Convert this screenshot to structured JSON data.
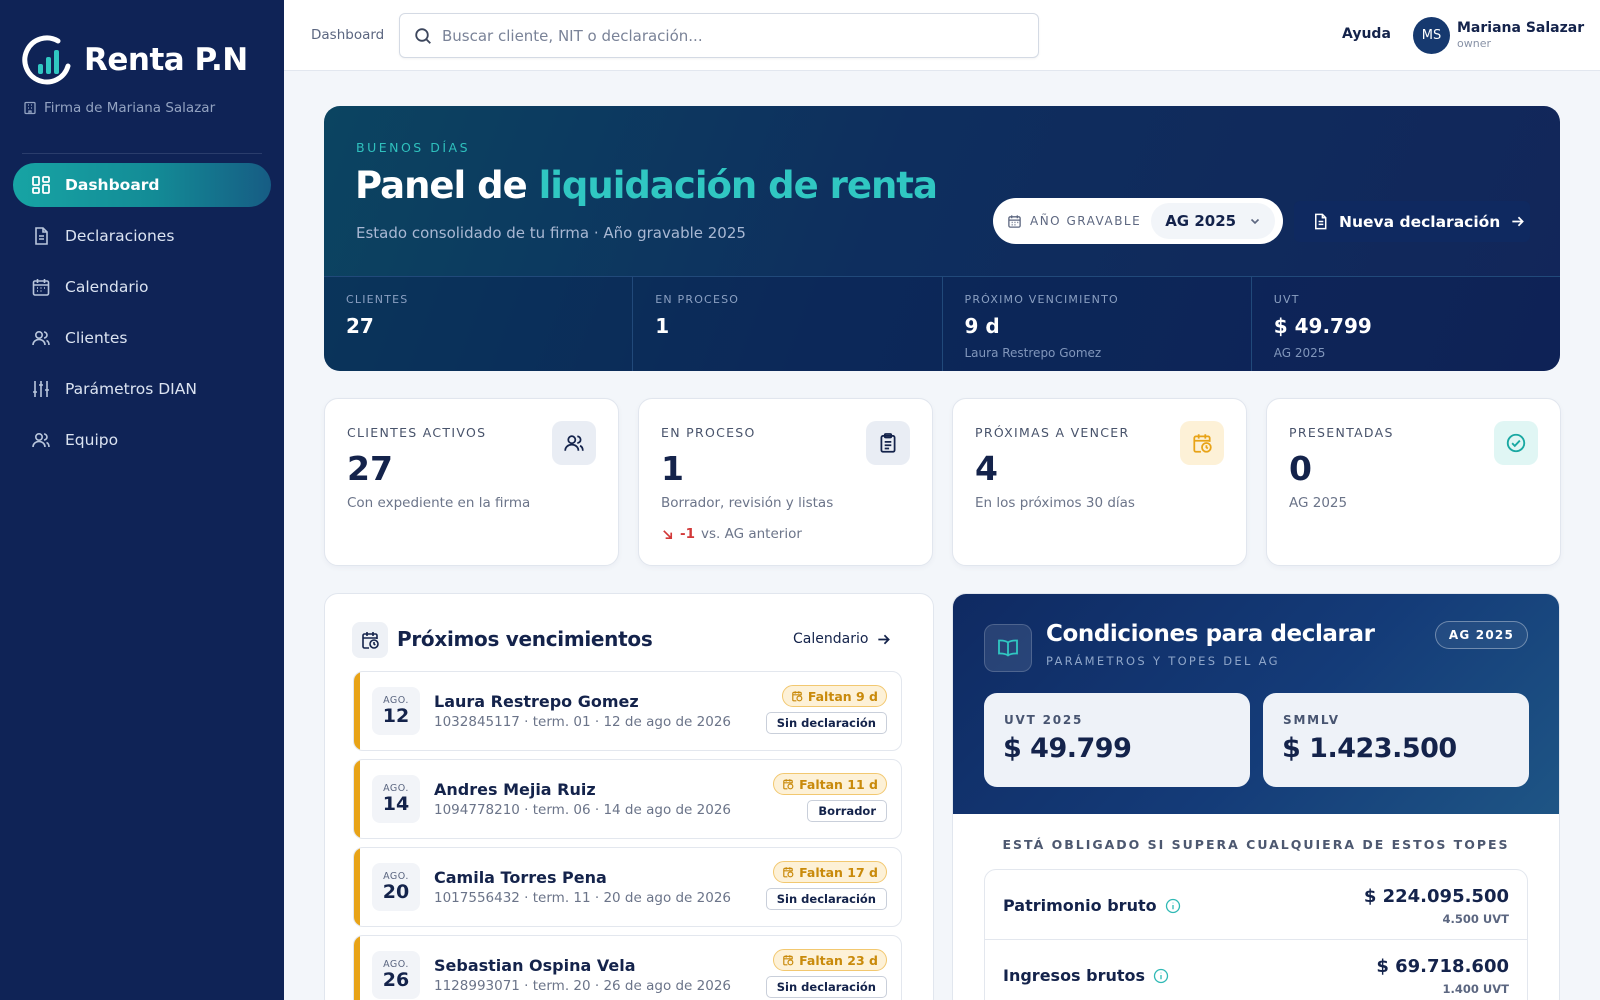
{
  "sidebar": {
    "brand": "Renta P.N",
    "firm": "Firma de Mariana Salazar",
    "items": [
      {
        "label": "Dashboard",
        "icon": "dashboard-grid-icon",
        "active": true
      },
      {
        "label": "Declaraciones",
        "icon": "document-icon"
      },
      {
        "label": "Calendario",
        "icon": "calendar-icon"
      },
      {
        "label": "Clientes",
        "icon": "users-icon"
      },
      {
        "label": "Parámetros DIAN",
        "icon": "sliders-icon"
      },
      {
        "label": "Equipo",
        "icon": "team-icon"
      }
    ]
  },
  "header": {
    "breadcrumb": "Dashboard",
    "search_placeholder": "Buscar cliente, NIT o declaración...",
    "help": "Ayuda",
    "user": {
      "initials": "MS",
      "name": "Mariana Salazar",
      "role": "owner"
    }
  },
  "hero": {
    "greeting": "BUENOS DÍAS",
    "title_prefix": "Panel de ",
    "title_accent": "liquidación de renta",
    "subtitle": "Estado consolidado de tu firma · Año gravable 2025",
    "year_label": "AÑO GRAVABLE",
    "year_value": "AG 2025",
    "new_button": "Nueva declaración",
    "stats": [
      {
        "label": "CLIENTES",
        "value": "27",
        "note": ""
      },
      {
        "label": "EN PROCESO",
        "value": "1",
        "note": ""
      },
      {
        "label": "PRÓXIMO VENCIMIENTO",
        "value": "9 d",
        "note": "Laura Restrepo Gomez"
      },
      {
        "label": "UVT",
        "value": "$ 49.799",
        "note": "AG 2025"
      }
    ]
  },
  "kpis": [
    {
      "label": "CLIENTES ACTIVOS",
      "value": "27",
      "desc": "Con expediente en la firma",
      "icon": "users-icon"
    },
    {
      "label": "EN PROCESO",
      "value": "1",
      "desc": "Borrador, revisión y listas",
      "trend_value": "-1",
      "trend_text": "vs. AG anterior",
      "icon": "clipboard-icon"
    },
    {
      "label": "PRÓXIMAS A VENCER",
      "value": "4",
      "desc": "En los próximos 30 días",
      "icon": "calendar-clock-icon"
    },
    {
      "label": "PRESENTADAS",
      "value": "0",
      "desc": "AG 2025",
      "icon": "check-circle-icon"
    }
  ],
  "deadlines": {
    "title": "Próximos vencimientos",
    "link": "Calendario",
    "items": [
      {
        "month": "AGO.",
        "day": "12",
        "name": "Laura Restrepo Gomez",
        "meta": "1032845117 · term. 01 · 12 de ago de 2026",
        "due": "Faltan 9 d",
        "status": "Sin declaración"
      },
      {
        "month": "AGO.",
        "day": "14",
        "name": "Andres Mejia Ruiz",
        "meta": "1094778210 · term. 06 · 14 de ago de 2026",
        "due": "Faltan 11 d",
        "status": "Borrador"
      },
      {
        "month": "AGO.",
        "day": "20",
        "name": "Camila Torres Pena",
        "meta": "1017556432 · term. 11 · 20 de ago de 2026",
        "due": "Faltan 17 d",
        "status": "Sin declaración"
      },
      {
        "month": "AGO.",
        "day": "26",
        "name": "Sebastian Ospina Vela",
        "meta": "1128993071 · term. 20 · 26 de ago de 2026",
        "due": "Faltan 23 d",
        "status": "Sin declaración"
      }
    ]
  },
  "conditions": {
    "title": "Condiciones para declarar",
    "subtitle": "PARÁMETROS Y TOPES DEL AG",
    "badge": "AG 2025",
    "params": [
      {
        "label": "UVT 2025",
        "value": "$ 49.799"
      },
      {
        "label": "SMMLV",
        "value": "$ 1.423.500"
      }
    ],
    "note": "ESTÁ OBLIGADO SI SUPERA CUALQUIERA DE ESTOS TOPES",
    "thresholds": [
      {
        "name": "Patrimonio bruto",
        "value": "$ 224.095.500",
        "uvt": "4.500 UVT"
      },
      {
        "name": "Ingresos brutos",
        "value": "$ 69.718.600",
        "uvt": "1.400 UVT"
      }
    ]
  },
  "colors": {
    "sidebar": "#0f2356",
    "accent": "#30c7c2",
    "warning": "#e8a317",
    "danger": "#d23939"
  }
}
